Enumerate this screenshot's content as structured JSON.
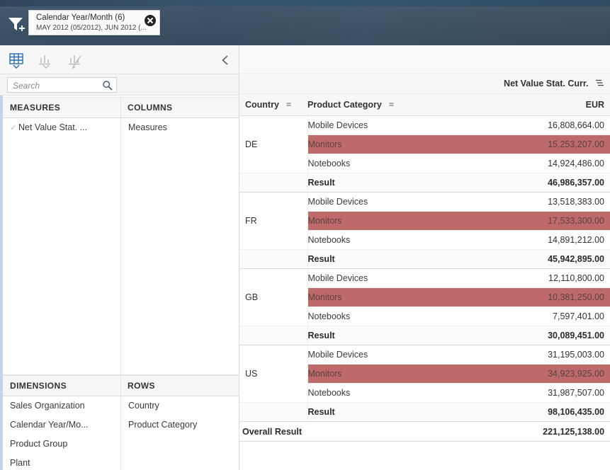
{
  "topbar": {
    "filter_icon": "filter-add-icon",
    "chip": {
      "title": "Calendar Year/Month (6)",
      "subtitle": "MAY 2012 (05/2012), JUN 2012 (...",
      "close_label": "Remove filter"
    }
  },
  "left_panel": {
    "view_tabs": [
      {
        "name": "table-view",
        "icon": "grid-table-icon",
        "active": true
      },
      {
        "name": "chart-view",
        "icon": "bar-chart-icon",
        "active": false
      },
      {
        "name": "chart-edit-view",
        "icon": "bar-chart-pen-icon",
        "active": false
      }
    ],
    "collapse_icon": "chevron-left-icon",
    "search": {
      "placeholder": "Search",
      "value": "",
      "icon": "search-icon"
    },
    "measures": {
      "header": "MEASURES",
      "items": [
        {
          "label": "Net Value Stat. ...",
          "checked": true
        }
      ]
    },
    "columns": {
      "header": "COLUMNS",
      "items": [
        {
          "label": "Measures"
        }
      ]
    },
    "dimensions": {
      "header": "DIMENSIONS",
      "items": [
        {
          "label": "Sales Organization"
        },
        {
          "label": "Calendar Year/Mo..."
        },
        {
          "label": "Product Group"
        },
        {
          "label": "Plant"
        }
      ]
    },
    "rows": {
      "header": "ROWS",
      "items": [
        {
          "label": "Country"
        },
        {
          "label": "Product Category"
        }
      ]
    }
  },
  "table": {
    "measure_header": "Net Value Stat. Curr.",
    "measure_sort_icon": "sort-descending-icon",
    "columns": {
      "country": "Country",
      "category": "Product Category",
      "value": "EUR"
    },
    "sort_icon": "sort-indicator-icon",
    "highlight_color": "#bf6a6a",
    "result_label": "Result",
    "overall_label": "Overall Result",
    "overall_value": "221,125,138.00",
    "groups": [
      {
        "country": "DE",
        "rows": [
          {
            "category": "Mobile Devices",
            "value": "16,808,664.00",
            "highlight": false
          },
          {
            "category": "Monitors",
            "value": "15,253,207.00",
            "highlight": true
          },
          {
            "category": "Notebooks",
            "value": "14,924,486.00",
            "highlight": false
          }
        ],
        "result": "46,986,357.00"
      },
      {
        "country": "FR",
        "rows": [
          {
            "category": "Mobile Devices",
            "value": "13,518,383.00",
            "highlight": false
          },
          {
            "category": "Monitors",
            "value": "17,533,300.00",
            "highlight": true
          },
          {
            "category": "Notebooks",
            "value": "14,891,212.00",
            "highlight": false
          }
        ],
        "result": "45,942,895.00"
      },
      {
        "country": "GB",
        "rows": [
          {
            "category": "Mobile Devices",
            "value": "12,110,800.00",
            "highlight": false
          },
          {
            "category": "Monitors",
            "value": "10,381,250.00",
            "highlight": true
          },
          {
            "category": "Notebooks",
            "value": "7,597,401.00",
            "highlight": false
          }
        ],
        "result": "30,089,451.00"
      },
      {
        "country": "US",
        "rows": [
          {
            "category": "Mobile Devices",
            "value": "31,195,003.00",
            "highlight": false
          },
          {
            "category": "Monitors",
            "value": "34,923,925.00",
            "highlight": true
          },
          {
            "category": "Notebooks",
            "value": "31,987,507.00",
            "highlight": false
          }
        ],
        "result": "98,106,435.00"
      }
    ]
  }
}
